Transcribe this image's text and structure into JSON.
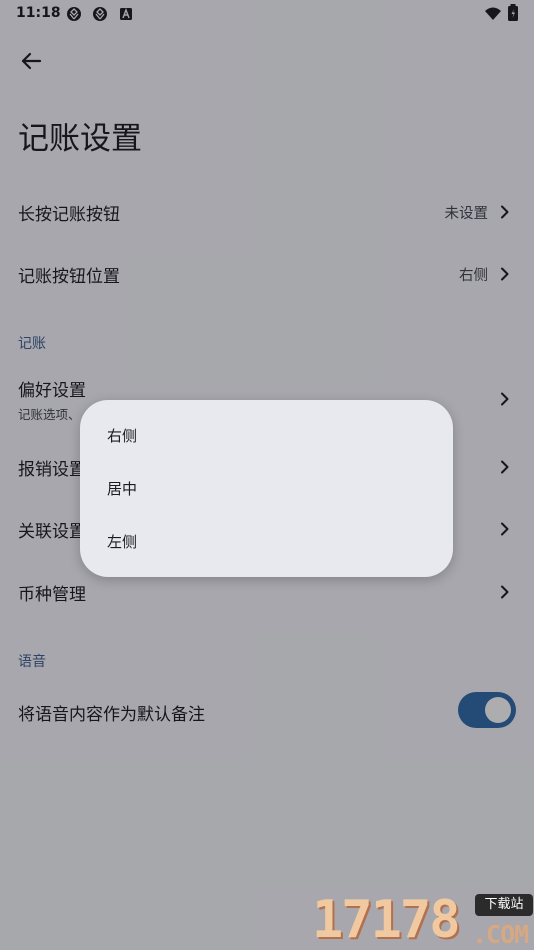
{
  "status_bar": {
    "time": "11:18",
    "left_icons": [
      "aperture-icon",
      "aperture-icon",
      "a-square-icon"
    ],
    "right_icons": [
      "wifi-icon",
      "battery-icon"
    ]
  },
  "header": {
    "back_icon": "arrow-left-icon",
    "title": "记账设置"
  },
  "settings": {
    "long_press": {
      "label": "长按记账按钮",
      "value": "未设置"
    },
    "button_position": {
      "label": "记账按钮位置",
      "value": "右侧"
    },
    "section_bookkeeping": "记账",
    "preferences": {
      "label": "偏好设置",
      "subtitle": "记账选项、"
    },
    "reimbursement": {
      "label": "报销设置"
    },
    "linking": {
      "label": "关联设置"
    },
    "currency": {
      "label": "币种管理"
    },
    "section_voice": "语音",
    "voice_note": {
      "label": "将语音内容作为默认备注",
      "toggle_on": true
    }
  },
  "popup_menu": {
    "items": [
      "右侧",
      "居中",
      "左侧"
    ]
  },
  "watermark": {
    "digits": "17178",
    "badge": "下载站",
    "domain": ".COM"
  },
  "colors": {
    "background": "#f6f6fa",
    "accent": "#2f6aa7",
    "section_header": "#3d5f90",
    "popup_bg": "#e8e8ef"
  }
}
